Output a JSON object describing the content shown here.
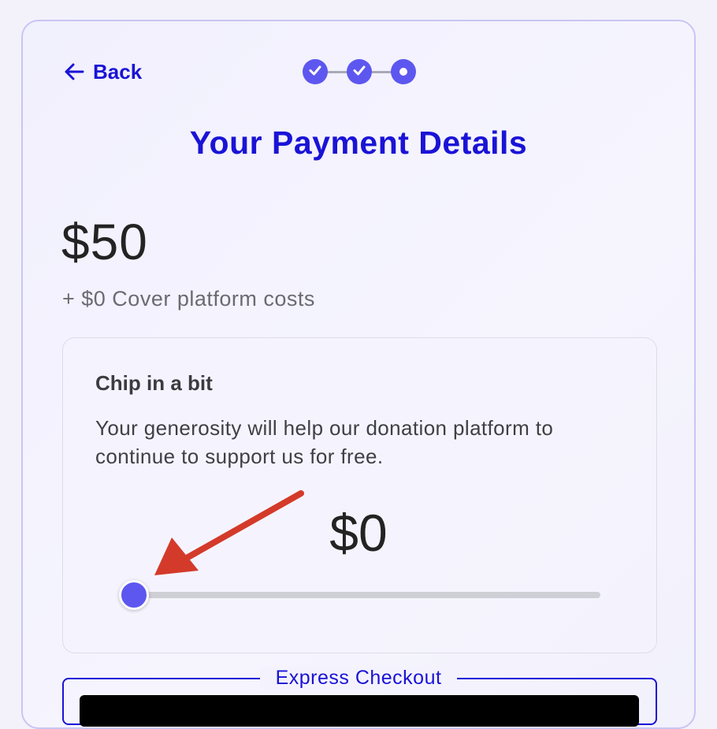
{
  "nav": {
    "back_label": "Back",
    "steps": [
      {
        "state": "completed"
      },
      {
        "state": "completed"
      },
      {
        "state": "current"
      }
    ]
  },
  "page": {
    "title": "Your Payment Details"
  },
  "donation": {
    "amount": "$50",
    "cover_text": "+ $0 Cover platform costs"
  },
  "chip_in": {
    "title": "Chip in a bit",
    "description": "Your generosity will help our donation platform to continue to support us for free.",
    "amount": "$0",
    "slider_level": 0
  },
  "express_checkout": {
    "label": "Express Checkout"
  },
  "colors": {
    "accent": "#1a13d6",
    "step": "#5d57f0",
    "annotation_arrow": "#d43a2a"
  }
}
